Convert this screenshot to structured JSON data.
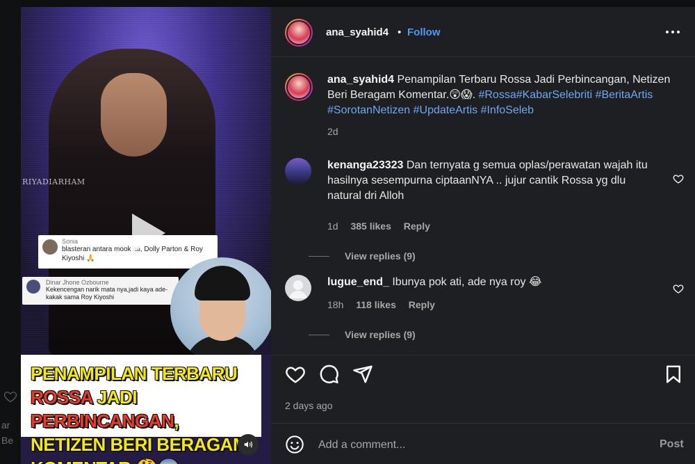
{
  "background_feed": {
    "fragment_1": "ar",
    "fragment_2": "Be"
  },
  "media": {
    "watermark": "RIYADIARHAM",
    "comment_card_1": {
      "name": "Sonia",
      "text": "blasteran antara mook ati, Dolly Parton & Roy Kiyoshi 🙏"
    },
    "comment_card_2": {
      "name": "Dinar Jhone Ozbourne",
      "text": "Kekencengan narik mata nya,jadi kaya ade-kakak sama Roy Kiyoshi"
    },
    "headline": {
      "part1": "PENAMPILAN TERBARU ",
      "part2": "ROSSA",
      "part3": " JADI ",
      "part4": "PERBINCANGAN",
      "part5": ", NETIZEN BERI BERAGAM KOMENTAR.",
      "emoji": "🤔😱"
    }
  },
  "header": {
    "username": "ana_syahid4",
    "separator": "•",
    "follow_label": "Follow"
  },
  "caption": {
    "username": "ana_syahid4",
    "text": "Penampilan Terbaru Rossa Jadi Perbincangan, Netizen Beri Beragam Komentar.",
    "emoji": "😲😱",
    "period": ".",
    "hashtags": "#Rossa#KabarSelebriti #BeritaArtis #SorotanNetizen #UpdateArtis #InfoSeleb",
    "time": "2d"
  },
  "comments": [
    {
      "username": "kenanga23323",
      "text": "Dan ternyata g semua oplas/perawatan wajah itu hasilnya sesempurna ciptaanNYA .. jujur cantik Rossa yg dlu natural dri Alloh",
      "time": "1d",
      "likes": "385 likes",
      "reply": "Reply",
      "view_replies": "View replies (9)"
    },
    {
      "username": "lugue_end_",
      "text": "Ibunya pok ati, ade nya roy 😂",
      "time": "18h",
      "likes": "118 likes",
      "reply": "Reply",
      "view_replies": "View replies (9)"
    }
  ],
  "actions": {
    "date": "2 days ago"
  },
  "add_comment": {
    "placeholder": "Add a comment...",
    "post_label": "Post"
  },
  "colors": {
    "panel_bg": "#1e1f22",
    "link_blue": "#4e9bf5",
    "hashtag_blue": "#6fa8f0",
    "headline_yellow": "#f2e61e",
    "headline_red": "#e53b2a"
  }
}
